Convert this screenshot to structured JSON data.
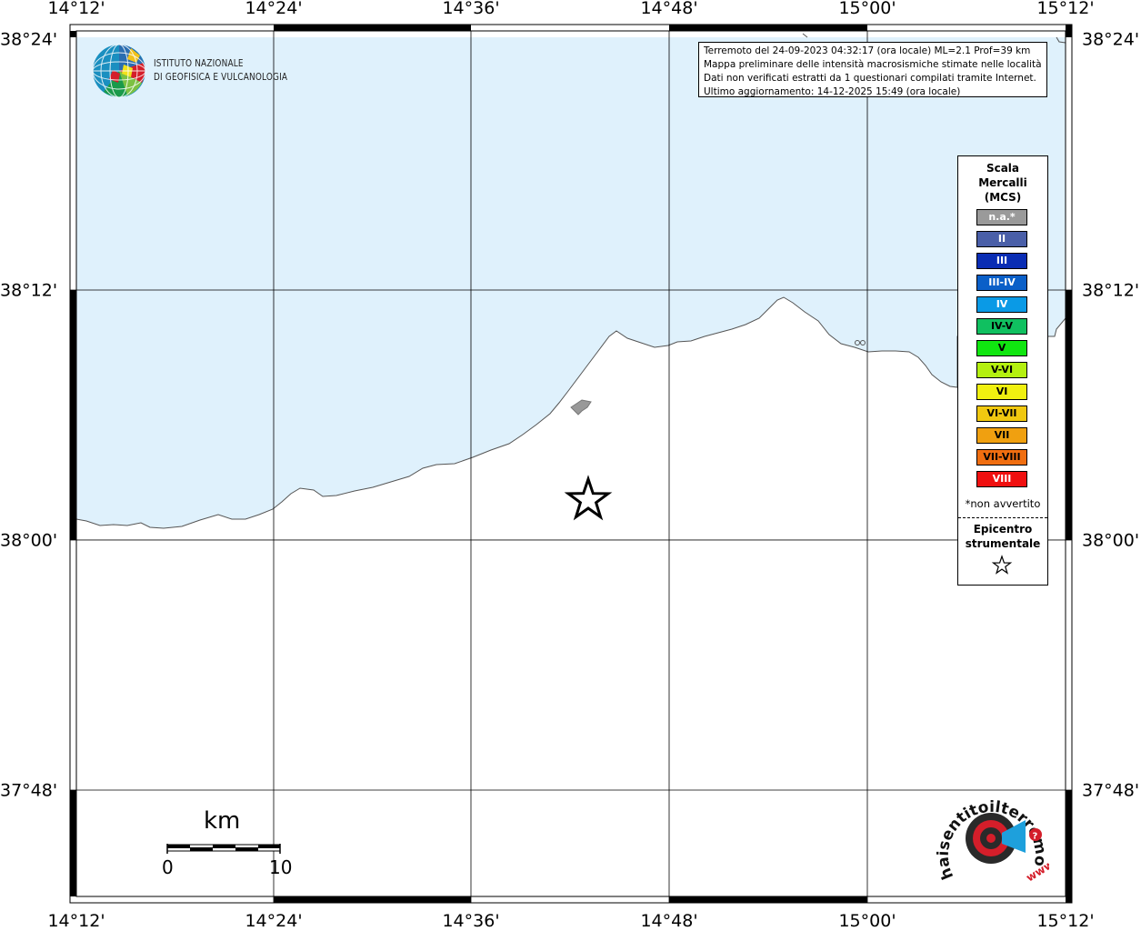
{
  "map": {
    "coords_top": [
      "14°12'",
      "14°24'",
      "14°36'",
      "14°48'",
      "15°00'",
      "15°12'"
    ],
    "coords_bottom": [
      "14°12'",
      "14°24'",
      "14°36'",
      "14°48'",
      "15°00'",
      "15°12'"
    ],
    "coords_left": [
      "38°24'",
      "38°12'",
      "38°00'",
      "37°48'"
    ],
    "coords_right": [
      "38°24'",
      "38°12'",
      "38°00'",
      "37°48'"
    ],
    "sea_color": "#dff1fc",
    "land_color": "#ffffff",
    "coast_color": "#555555"
  },
  "info": {
    "line1": "Terremoto del 24-09-2023 04:32:17 (ora locale) ML=2.1 Prof=39 km",
    "line2": "Mappa preliminare delle intensità macrosismiche stimate nelle località",
    "line3": "Dati non verificati estratti da 1 questionari compilati tramite Internet.",
    "line4": "Ultimo aggiornamento: 14-12-2025 15:49 (ora locale)"
  },
  "ingv_logo": {
    "line1": "ISTITUTO NAZIONALE",
    "line2": "DI GEOFISICA E VULCANOLOGIA"
  },
  "legend": {
    "title_line1": "Scala",
    "title_line2": "Mercalli",
    "title_line3": "(MCS)",
    "items": [
      {
        "label": "n.a.*",
        "color": "#9a9a9a",
        "text_color": "#ffffff"
      },
      {
        "label": "II",
        "color": "#4a5fa8",
        "text_color": "#ffffff"
      },
      {
        "label": "III",
        "color": "#0a2db4",
        "text_color": "#ffffff"
      },
      {
        "label": "III-IV",
        "color": "#0a5fc8",
        "text_color": "#ffffff"
      },
      {
        "label": "IV",
        "color": "#0a9ae6",
        "text_color": "#ffffff"
      },
      {
        "label": "IV-V",
        "color": "#10c060",
        "text_color": "#000000"
      },
      {
        "label": "V",
        "color": "#10e610",
        "text_color": "#000000"
      },
      {
        "label": "V-VI",
        "color": "#b4f010",
        "text_color": "#000000"
      },
      {
        "label": "VI",
        "color": "#f0f010",
        "text_color": "#000000"
      },
      {
        "label": "VI-VII",
        "color": "#f0c810",
        "text_color": "#000000"
      },
      {
        "label": "VII",
        "color": "#f0a010",
        "text_color": "#000000"
      },
      {
        "label": "VII-VIII",
        "color": "#f06e10",
        "text_color": "#000000"
      },
      {
        "label": "VIII",
        "color": "#f01010",
        "text_color": "#ffffff"
      }
    ],
    "note": "*non avvertito",
    "epicenter_line1": "Epicentro",
    "epicenter_line2": "strumentale"
  },
  "scale_bar": {
    "unit": "km",
    "label_start": "0",
    "label_end": "10"
  },
  "hsit_logo": {
    "text_main": "haisentitoilterremoto.it",
    "text_www": "www."
  }
}
